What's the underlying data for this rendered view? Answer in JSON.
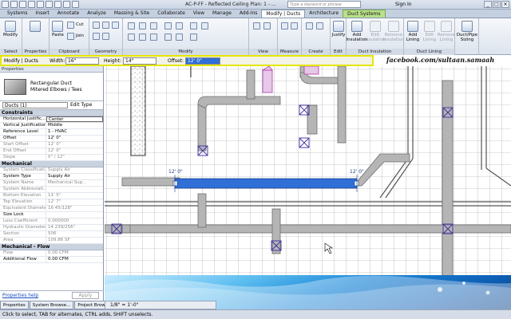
{
  "title_bar": {
    "window_title": "AC-P-FF - Reflected Ceiling Plan: 1 - ...",
    "search_placeholder": "Type a keyword or phrase",
    "sign_in": "Sign In"
  },
  "ribbon_tabs": [
    "Systems",
    "Insert",
    "Annotate",
    "Analyze",
    "Massing & Site",
    "Collaborate",
    "View",
    "Manage",
    "Add-Ins",
    "Modify | Ducts",
    "Architecture",
    "Duct Systems"
  ],
  "active_tab": "Modify | Ducts",
  "ribbon": {
    "select": {
      "label": "Select",
      "modify": "Modify"
    },
    "properties_panel": {
      "label": "Properties"
    },
    "clipboard": {
      "label": "Clipboard",
      "paste": "Paste",
      "cut": "Cut",
      "join": "Join"
    },
    "geometry": {
      "label": "Geometry"
    },
    "modify": {
      "label": "Modify"
    },
    "view": {
      "label": "View"
    },
    "measure": {
      "label": "Measure"
    },
    "create": {
      "label": "Create"
    },
    "edit": {
      "label": "Edit",
      "justify": "Justify"
    },
    "duct_insulation": {
      "label": "Duct Insulation",
      "add": "Add Insulation",
      "edit": "Edit Insulation",
      "remove": "Remove Insulation"
    },
    "duct_lining": {
      "label": "Duct Lining",
      "add": "Add Lining",
      "edit": "Edit Lining",
      "remove": "Remove Lining"
    },
    "sizing": {
      "label": "Duct/Pipe Sizing"
    }
  },
  "options_bar": {
    "mode": "Modify | Ducts",
    "width_label": "Width:",
    "width_value": "16\"",
    "height_label": "Height:",
    "height_value": "14\"",
    "offset_label": "Offset:",
    "offset_value": "12' 0\""
  },
  "watermark": "facebook.com/sultaan.samaah",
  "properties": {
    "header": "Properties",
    "type_line1": "Rectangular Duct",
    "type_line2": "Mitered Elbows / Tees",
    "instance_selector": "Ducts (1)",
    "edit_type": "Edit Type",
    "groups": [
      {
        "name": "Constraints",
        "rows": [
          {
            "k": "Horizontal Justific...",
            "v": "Center",
            "ro": false
          },
          {
            "k": "Vertical Justification",
            "v": "Middle",
            "ro": false
          },
          {
            "k": "Reference Level",
            "v": "1 - HVAC",
            "ro": false
          },
          {
            "k": "Offset",
            "v": "12'  0\"",
            "ro": false
          },
          {
            "k": "Start Offset",
            "v": "12'  0\"",
            "ro": true
          },
          {
            "k": "End Offset",
            "v": "12'  0\"",
            "ro": true
          },
          {
            "k": "Slope",
            "v": "0\" / 12\"",
            "ro": true
          }
        ]
      },
      {
        "name": "Mechanical",
        "rows": [
          {
            "k": "System Classificati...",
            "v": "Supply Air",
            "ro": true
          },
          {
            "k": "System Type",
            "v": "Supply Air",
            "ro": false
          },
          {
            "k": "System Name",
            "v": "Mechanical Sup...",
            "ro": true
          },
          {
            "k": "System Abbreviati...",
            "v": "",
            "ro": true
          },
          {
            "k": "Bottom Elevation",
            "v": "11'  5\"",
            "ro": true
          },
          {
            "k": "Top Elevation",
            "v": "12'  7\"",
            "ro": true
          },
          {
            "k": "Equivalent Diameter",
            "v": "16 45/128\"",
            "ro": true
          },
          {
            "k": "Size Lock",
            "v": "",
            "ro": false
          },
          {
            "k": "Loss Coefficient",
            "v": "0.000000",
            "ro": true
          },
          {
            "k": "Hydraulic Diameter",
            "v": "14 239/256\"",
            "ro": true
          },
          {
            "k": "Section",
            "v": "506",
            "ro": true
          },
          {
            "k": "Area",
            "v": "109.86 SF",
            "ro": true
          }
        ]
      },
      {
        "name": "Mechanical - Flow",
        "rows": [
          {
            "k": "Flow",
            "v": "0.00 CFM",
            "ro": true
          },
          {
            "k": "Additional Flow",
            "v": "0.00 CFM",
            "ro": false
          }
        ]
      }
    ],
    "help_link": "Properties help",
    "apply": "Apply"
  },
  "bottom_tabs": [
    "Properties",
    "System Browse...",
    "Project Browse..."
  ],
  "view_scale": "1/8\" = 1'-0\"",
  "dim_labels": [
    "12' 0\"",
    "12' 0\""
  ],
  "status_text": "Click to select, TAB for alternates, CTRL adds, SHIFT unselects."
}
